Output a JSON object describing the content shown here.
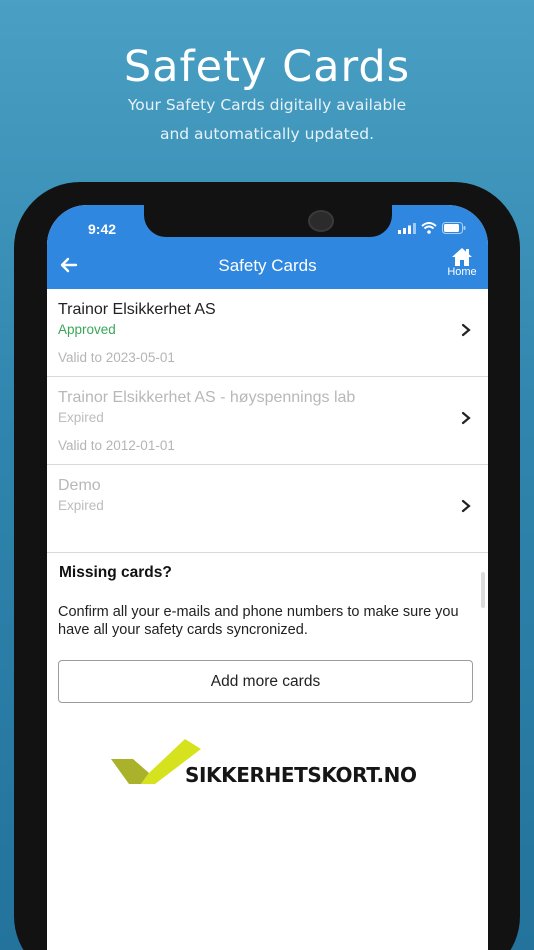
{
  "promo": {
    "title": "Safety Cards",
    "subtitle_line1": "Your Safety Cards digitally available",
    "subtitle_line2": "and automatically updated."
  },
  "status_bar": {
    "time": "9:42",
    "icons": [
      "signal-icon",
      "wifi-icon",
      "battery-icon"
    ]
  },
  "app_bar": {
    "title": "Safety Cards",
    "back_icon": "arrow-left-icon",
    "home_label": "Home",
    "home_icon": "home-icon"
  },
  "cards": [
    {
      "name": "Trainor Elsikkerhet AS",
      "status": "Approved",
      "valid": "Valid to 2023-05-01"
    },
    {
      "name": "Trainor Elsikkerhet AS - høyspennings lab",
      "status": "Expired",
      "valid": "Valid to 2012-01-01"
    },
    {
      "name": "Demo",
      "status": "Expired",
      "valid": ""
    }
  ],
  "missing": {
    "title": "Missing cards?",
    "text": "Confirm all your e-mails and phone numbers to make sure you have all your safety cards syncronized.",
    "button_label": "Add more cards"
  },
  "logo": {
    "text": "SIKKERHETSKORT.NO"
  },
  "colors": {
    "app_blue": "#2f87df",
    "approved_green": "#3aa65a",
    "logo_lime": "#d6e21e",
    "logo_olive": "#a9b22a"
  }
}
